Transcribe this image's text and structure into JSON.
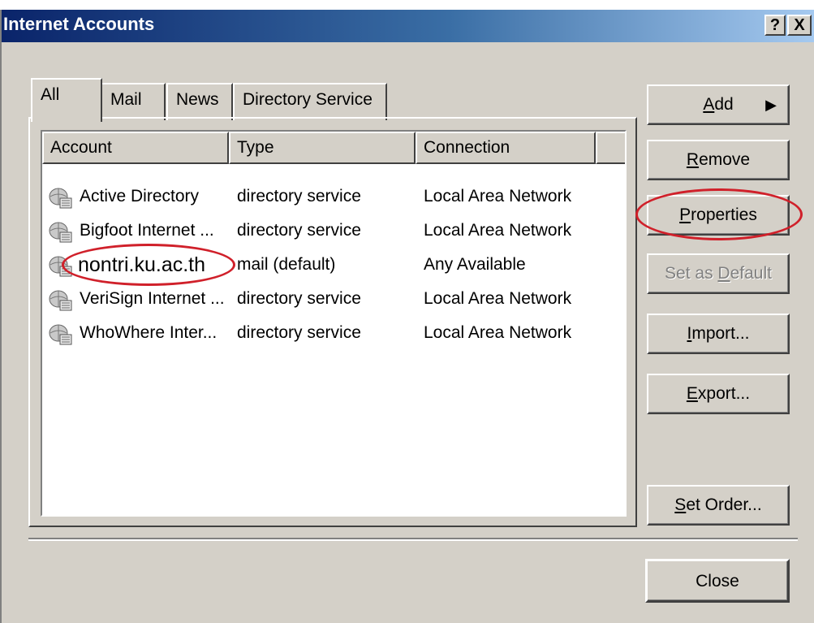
{
  "window": {
    "title": "Internet Accounts",
    "help_label": "?",
    "close_label": "X"
  },
  "tabs": [
    {
      "label": "All",
      "active": true
    },
    {
      "label": "Mail",
      "active": false
    },
    {
      "label": "News",
      "active": false
    },
    {
      "label": "Directory Service",
      "active": false
    }
  ],
  "list": {
    "columns": [
      "Account",
      "Type",
      "Connection"
    ],
    "rows": [
      {
        "account": "Active Directory",
        "type": "directory service",
        "connection": "Local Area Network"
      },
      {
        "account": "Bigfoot Internet ...",
        "type": "directory service",
        "connection": "Local Area Network"
      },
      {
        "account": "nontri.ku.ac.th",
        "type": "mail (default)",
        "connection": "Any Available"
      },
      {
        "account": "VeriSign Internet ...",
        "type": "directory service",
        "connection": "Local Area Network"
      },
      {
        "account": "WhoWhere Inter...",
        "type": "directory service",
        "connection": "Local Area Network"
      }
    ]
  },
  "buttons": {
    "add": {
      "pre": "",
      "key": "A",
      "post": "dd",
      "arrow": "▶"
    },
    "remove": {
      "pre": "",
      "key": "R",
      "post": "emove"
    },
    "properties": {
      "pre": "",
      "key": "P",
      "post": "roperties"
    },
    "set_default": {
      "pre": "Set as ",
      "key": "D",
      "post": "efault"
    },
    "import": {
      "pre": "",
      "key": "I",
      "post": "mport..."
    },
    "export": {
      "pre": "",
      "key": "E",
      "post": "xport..."
    },
    "set_order": {
      "pre": "",
      "key": "S",
      "post": "et Order..."
    },
    "close": {
      "pre": "Close",
      "key": "",
      "post": ""
    }
  },
  "colors": {
    "title_gradient_start": "#0a246a",
    "dialog_face": "#d4d0c8",
    "annotation_red": "#d0202a"
  }
}
